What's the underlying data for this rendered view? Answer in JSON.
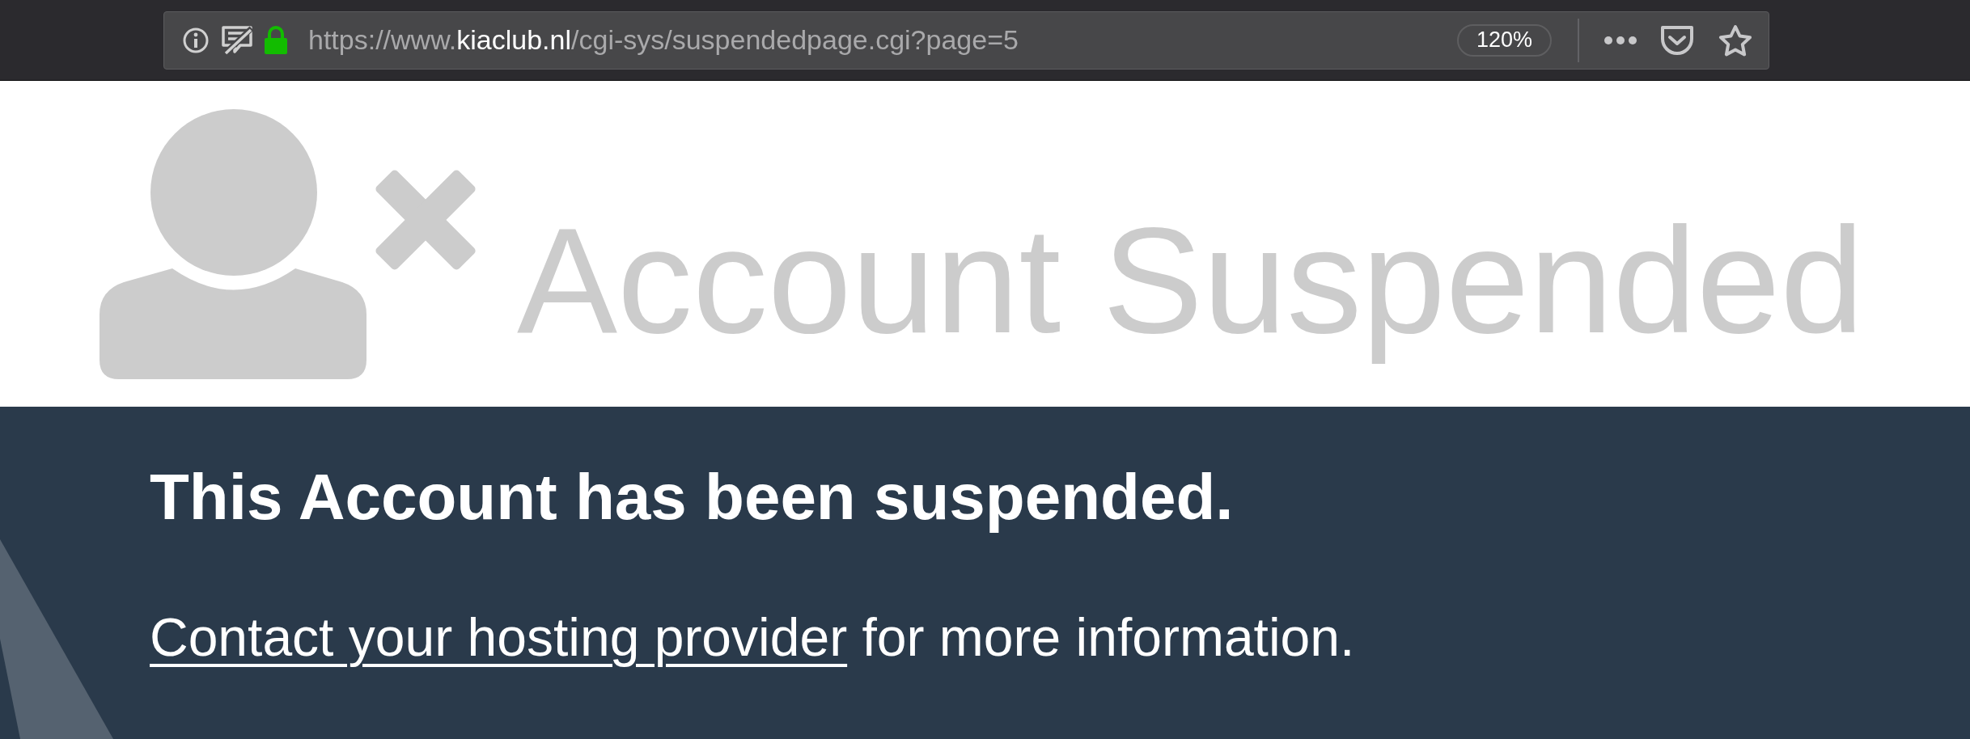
{
  "toolbar": {
    "url": {
      "scheme": "https://www.",
      "domain": "kiaclub.nl",
      "path": "/cgi-sys/suspendedpage.cgi?page=5"
    },
    "zoom": "120%"
  },
  "banner": {
    "title": "Account Suspended"
  },
  "notice": {
    "heading": "This Account has been suspended.",
    "link": "Contact your hosting provider",
    "text": " for more information."
  }
}
